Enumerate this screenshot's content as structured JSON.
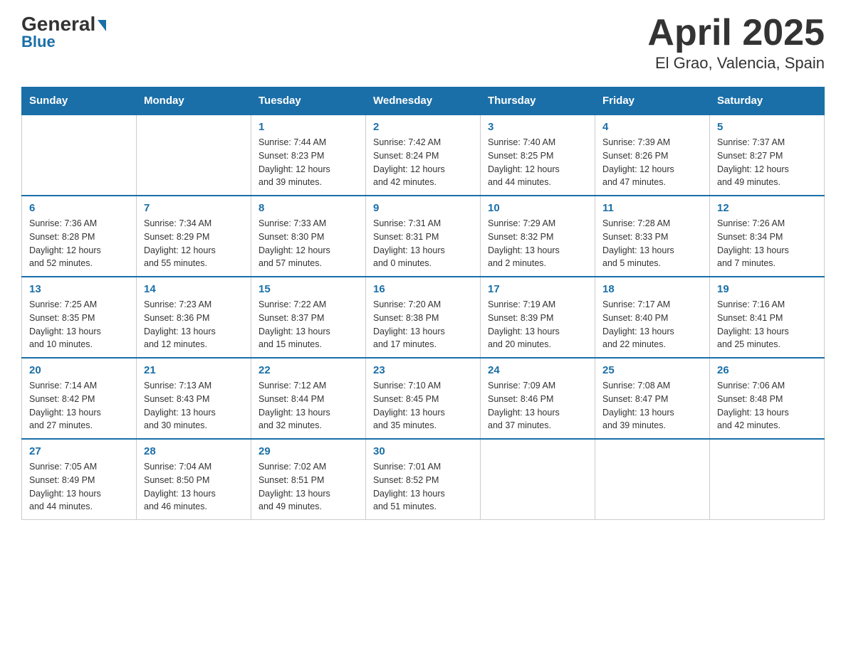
{
  "header": {
    "logo_line1": "General",
    "logo_line2": "Blue",
    "title": "April 2025",
    "subtitle": "El Grao, Valencia, Spain"
  },
  "days_of_week": [
    "Sunday",
    "Monday",
    "Tuesday",
    "Wednesday",
    "Thursday",
    "Friday",
    "Saturday"
  ],
  "weeks": [
    [
      {
        "day": "",
        "info": ""
      },
      {
        "day": "",
        "info": ""
      },
      {
        "day": "1",
        "info": "Sunrise: 7:44 AM\nSunset: 8:23 PM\nDaylight: 12 hours\nand 39 minutes."
      },
      {
        "day": "2",
        "info": "Sunrise: 7:42 AM\nSunset: 8:24 PM\nDaylight: 12 hours\nand 42 minutes."
      },
      {
        "day": "3",
        "info": "Sunrise: 7:40 AM\nSunset: 8:25 PM\nDaylight: 12 hours\nand 44 minutes."
      },
      {
        "day": "4",
        "info": "Sunrise: 7:39 AM\nSunset: 8:26 PM\nDaylight: 12 hours\nand 47 minutes."
      },
      {
        "day": "5",
        "info": "Sunrise: 7:37 AM\nSunset: 8:27 PM\nDaylight: 12 hours\nand 49 minutes."
      }
    ],
    [
      {
        "day": "6",
        "info": "Sunrise: 7:36 AM\nSunset: 8:28 PM\nDaylight: 12 hours\nand 52 minutes."
      },
      {
        "day": "7",
        "info": "Sunrise: 7:34 AM\nSunset: 8:29 PM\nDaylight: 12 hours\nand 55 minutes."
      },
      {
        "day": "8",
        "info": "Sunrise: 7:33 AM\nSunset: 8:30 PM\nDaylight: 12 hours\nand 57 minutes."
      },
      {
        "day": "9",
        "info": "Sunrise: 7:31 AM\nSunset: 8:31 PM\nDaylight: 13 hours\nand 0 minutes."
      },
      {
        "day": "10",
        "info": "Sunrise: 7:29 AM\nSunset: 8:32 PM\nDaylight: 13 hours\nand 2 minutes."
      },
      {
        "day": "11",
        "info": "Sunrise: 7:28 AM\nSunset: 8:33 PM\nDaylight: 13 hours\nand 5 minutes."
      },
      {
        "day": "12",
        "info": "Sunrise: 7:26 AM\nSunset: 8:34 PM\nDaylight: 13 hours\nand 7 minutes."
      }
    ],
    [
      {
        "day": "13",
        "info": "Sunrise: 7:25 AM\nSunset: 8:35 PM\nDaylight: 13 hours\nand 10 minutes."
      },
      {
        "day": "14",
        "info": "Sunrise: 7:23 AM\nSunset: 8:36 PM\nDaylight: 13 hours\nand 12 minutes."
      },
      {
        "day": "15",
        "info": "Sunrise: 7:22 AM\nSunset: 8:37 PM\nDaylight: 13 hours\nand 15 minutes."
      },
      {
        "day": "16",
        "info": "Sunrise: 7:20 AM\nSunset: 8:38 PM\nDaylight: 13 hours\nand 17 minutes."
      },
      {
        "day": "17",
        "info": "Sunrise: 7:19 AM\nSunset: 8:39 PM\nDaylight: 13 hours\nand 20 minutes."
      },
      {
        "day": "18",
        "info": "Sunrise: 7:17 AM\nSunset: 8:40 PM\nDaylight: 13 hours\nand 22 minutes."
      },
      {
        "day": "19",
        "info": "Sunrise: 7:16 AM\nSunset: 8:41 PM\nDaylight: 13 hours\nand 25 minutes."
      }
    ],
    [
      {
        "day": "20",
        "info": "Sunrise: 7:14 AM\nSunset: 8:42 PM\nDaylight: 13 hours\nand 27 minutes."
      },
      {
        "day": "21",
        "info": "Sunrise: 7:13 AM\nSunset: 8:43 PM\nDaylight: 13 hours\nand 30 minutes."
      },
      {
        "day": "22",
        "info": "Sunrise: 7:12 AM\nSunset: 8:44 PM\nDaylight: 13 hours\nand 32 minutes."
      },
      {
        "day": "23",
        "info": "Sunrise: 7:10 AM\nSunset: 8:45 PM\nDaylight: 13 hours\nand 35 minutes."
      },
      {
        "day": "24",
        "info": "Sunrise: 7:09 AM\nSunset: 8:46 PM\nDaylight: 13 hours\nand 37 minutes."
      },
      {
        "day": "25",
        "info": "Sunrise: 7:08 AM\nSunset: 8:47 PM\nDaylight: 13 hours\nand 39 minutes."
      },
      {
        "day": "26",
        "info": "Sunrise: 7:06 AM\nSunset: 8:48 PM\nDaylight: 13 hours\nand 42 minutes."
      }
    ],
    [
      {
        "day": "27",
        "info": "Sunrise: 7:05 AM\nSunset: 8:49 PM\nDaylight: 13 hours\nand 44 minutes."
      },
      {
        "day": "28",
        "info": "Sunrise: 7:04 AM\nSunset: 8:50 PM\nDaylight: 13 hours\nand 46 minutes."
      },
      {
        "day": "29",
        "info": "Sunrise: 7:02 AM\nSunset: 8:51 PM\nDaylight: 13 hours\nand 49 minutes."
      },
      {
        "day": "30",
        "info": "Sunrise: 7:01 AM\nSunset: 8:52 PM\nDaylight: 13 hours\nand 51 minutes."
      },
      {
        "day": "",
        "info": ""
      },
      {
        "day": "",
        "info": ""
      },
      {
        "day": "",
        "info": ""
      }
    ]
  ]
}
